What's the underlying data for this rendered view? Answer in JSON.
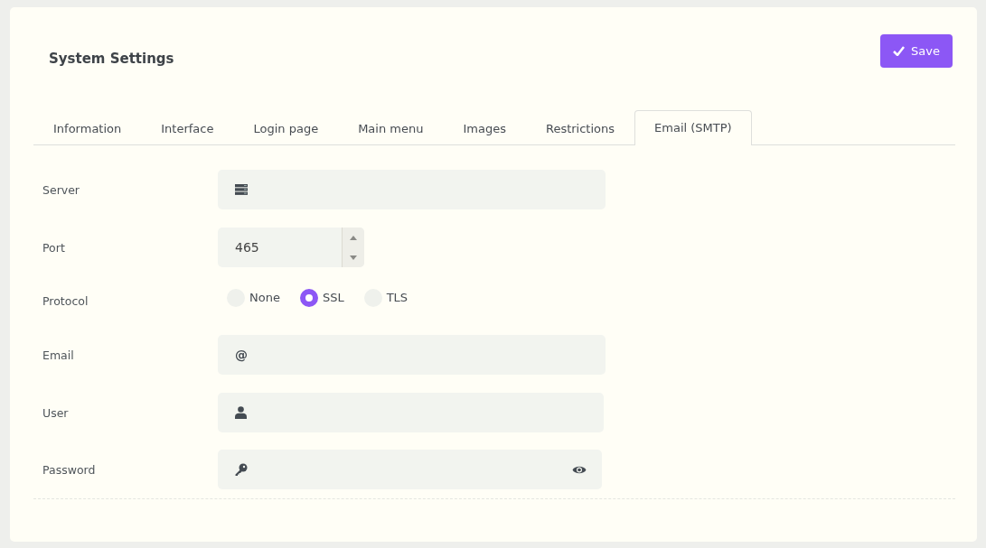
{
  "title": "System Settings",
  "save_button": {
    "label": "Save"
  },
  "tabs": [
    {
      "label": "Information",
      "selected": false
    },
    {
      "label": "Interface",
      "selected": false
    },
    {
      "label": "Login page",
      "selected": false
    },
    {
      "label": "Main menu",
      "selected": false
    },
    {
      "label": "Images",
      "selected": false
    },
    {
      "label": "Restrictions",
      "selected": false
    },
    {
      "label": "Email (SMTP)",
      "selected": true
    }
  ],
  "fields": [
    {
      "kind": "server",
      "label": "Server"
    },
    {
      "kind": "number",
      "label": "Port",
      "value": "465"
    },
    {
      "kind": "radio",
      "label": "Protocol",
      "options": [
        {
          "label": "None",
          "selected": false
        },
        {
          "label": "SSL",
          "selected": true
        },
        {
          "label": "TLS",
          "selected": false
        }
      ]
    },
    {
      "kind": "email",
      "label": "Email",
      "prefix": "@"
    },
    {
      "kind": "user",
      "label": "User"
    },
    {
      "kind": "password",
      "label": "Password"
    }
  ]
}
